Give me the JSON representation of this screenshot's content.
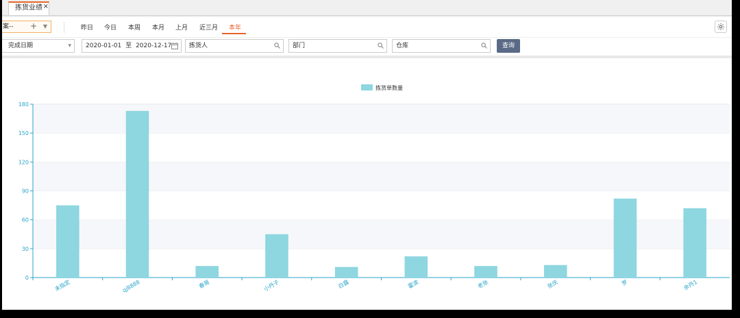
{
  "tabs": [
    {
      "label": "拣货业绩",
      "close": "×"
    }
  ],
  "toolbar": {
    "scheme_label": "案--",
    "scheme_add": "+",
    "scheme_caret": "▼",
    "periods": [
      "昨日",
      "今日",
      "本周",
      "本月",
      "上月",
      "近三月",
      "本年"
    ],
    "active_period": "本年"
  },
  "filters": {
    "date_type": "完成日期",
    "date_from": "2020-01-01",
    "date_sep": "至",
    "date_to": "2020-12-17",
    "picker": "拣货人",
    "department": "部门",
    "warehouse": "仓库",
    "query_label": "查询"
  },
  "colors": {
    "accent": "#e8632a",
    "bar": "#8ed6e0",
    "axis": "#2aa5c8",
    "button": "#5a6a86"
  },
  "chart_data": {
    "type": "bar",
    "legend": "拣货单数量",
    "categories": [
      "未指定",
      "qj8888",
      "春哥",
      "小丹子",
      "白露",
      "霍波",
      "老张",
      "张庆",
      "罗",
      "余丹1"
    ],
    "series": [
      {
        "name": "拣货单数量",
        "values": [
          75,
          173,
          12,
          45,
          11,
          22,
          12,
          13,
          82,
          72
        ]
      }
    ],
    "ylim": [
      0,
      180
    ],
    "yticks": [
      0,
      30,
      60,
      90,
      120,
      150,
      180
    ],
    "grid": true,
    "legend_position": "top-center"
  }
}
